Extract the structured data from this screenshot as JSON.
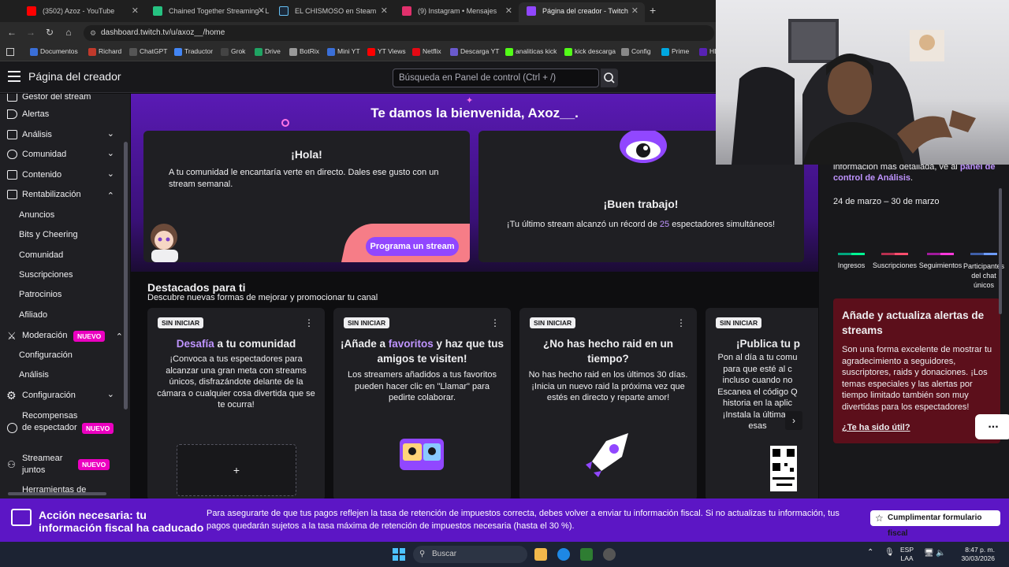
{
  "browser": {
    "tabs": [
      {
        "title": "(3502) Azoz - YouTube",
        "color": "#ff0000"
      },
      {
        "title": "Chained Together Streaming - L",
        "color": "#26c281"
      },
      {
        "title": "EL CHISMOSO en Steam",
        "color": "#1b2838"
      },
      {
        "title": "(9) Instagram • Mensajes",
        "color": "#e1306c"
      },
      {
        "title": "Página del creador - Twitch",
        "color": "#9147ff"
      }
    ],
    "url": "dashboard.twitch.tv/u/axoz__/home",
    "bookmarks": [
      "Documentos",
      "Richard",
      "ChatGPT",
      "Traductor",
      "Grok",
      "Drive",
      "BotRix",
      "Mini YT",
      "YT Views",
      "Netflix",
      "Descarga YT",
      "analiticas kick",
      "kick descarga",
      "Config",
      "Prime",
      "HB"
    ]
  },
  "header": {
    "title": "Página del creador",
    "search_placeholder": "Búsqueda en Panel de control (Ctrl + /)"
  },
  "sidebar": {
    "stream_manager": "Gestor del stream",
    "alerts": "Alertas",
    "analytics": "Análisis",
    "community": "Comunidad",
    "content": "Contenido",
    "monetization": "Rentabilización",
    "monetization_sub": [
      "Anuncios",
      "Bits y Cheering",
      "Comunidad",
      "Suscripciones",
      "Patrocinios",
      "Afiliado"
    ],
    "moderation": "Moderación",
    "new_badge": "NUEVO",
    "moderation_sub": [
      "Configuración",
      "Análisis"
    ],
    "settings": "Configuración",
    "rewards": "Recompensas de espectador",
    "stream_together": "Streamear juntos",
    "tools": "Herramientas de"
  },
  "main": {
    "welcome": "Te damos la bienvenida, Axoz__.",
    "hola_title": "¡Hola!",
    "hola_text": "A tu comunidad le encantaría verte en directo. Dales ese gusto con un stream semanal.",
    "schedule_button": "Programa un stream",
    "good_title": "¡Buen trabajo!",
    "good_text_pre": "¡Tu último stream alcanzó un récord de ",
    "good_text_num": "25",
    "good_text_post": " espectadores simultáneos!",
    "featured_title": "Destacados para ti",
    "featured_subtitle": "Descubre nuevas formas de mejorar y promocionar tu canal",
    "tag": "SIN INICIAR",
    "cards": [
      {
        "title_hl": "Desafía",
        "title_rest": " a tu comunidad",
        "text": "¡Convoca a tus espectadores para alcanzar una gran meta con streams únicos, disfrazándote delante de la cámara o cualquier cosa divertida que se te ocurra!"
      },
      {
        "title_pre": "¡Añade a ",
        "title_hl": "favoritos",
        "title_rest": " y haz que tus amigos te visiten!",
        "text": "Los streamers añadidos a tus favoritos pueden hacer clic en \"Llamar\" para pedirte colaborar."
      },
      {
        "title": "¿No has hecho raid en un tiempo?",
        "text": "No has hecho raid en los últimos 30 días. ¡Inicia un nuevo raid la próxima vez que estés en directo y reparte amor!"
      },
      {
        "title": "¡Publica tu p",
        "text": "Pon al día a tu comu para que esté al c incluso cuando no Escanea el código Q historia en la aplic ¡Instala la última v esas"
      }
    ],
    "add_symbol": "+"
  },
  "right": {
    "info_text": "información más detallada, ve al ",
    "info_link": "panel de control de Análisis",
    "dates": "24 de marzo – 30 de marzo",
    "legend": [
      {
        "label": "Ingresos",
        "colors": [
          "#00a67e",
          "#00f593"
        ]
      },
      {
        "label": "Suscripciones",
        "colors": [
          "#b72f4f",
          "#ff4d6d"
        ]
      },
      {
        "label": "Seguimientos",
        "colors": [
          "#a01a9c",
          "#ff38db"
        ]
      },
      {
        "label": "Participantes del chat únicos",
        "colors": [
          "#3f5ea8",
          "#6e9cff"
        ]
      }
    ],
    "alert_title": "Añade y actualiza alertas de streams",
    "alert_text": "Son una forma excelente de mostrar tu agradecimiento a seguidores, suscriptores, raids y donaciones. ¡Los temas especiales y las alertas por tiempo limitado también son muy divertidas para los espectadores!",
    "alert_link": "¿Te ha sido útil?",
    "chat_button": "..."
  },
  "banner": {
    "title": "Acción necesaria: tu información fiscal ha caducado",
    "text": "Para asegurarte de que tus pagos reflejen la tasa de retención de impuestos correcta, debes volver a enviar tu información fiscal. Si no actualizas tu información, tus pagos quedarán sujetos a la tasa máxima de retención de impuestos necesaria (hasta el 30 %).",
    "button": "Cumplimentar formulario fiscal"
  },
  "taskbar": {
    "search": "Buscar",
    "lang": "ESP",
    "region": "LAA",
    "time": "8:47 p. m.",
    "date": "30/03/2026"
  }
}
